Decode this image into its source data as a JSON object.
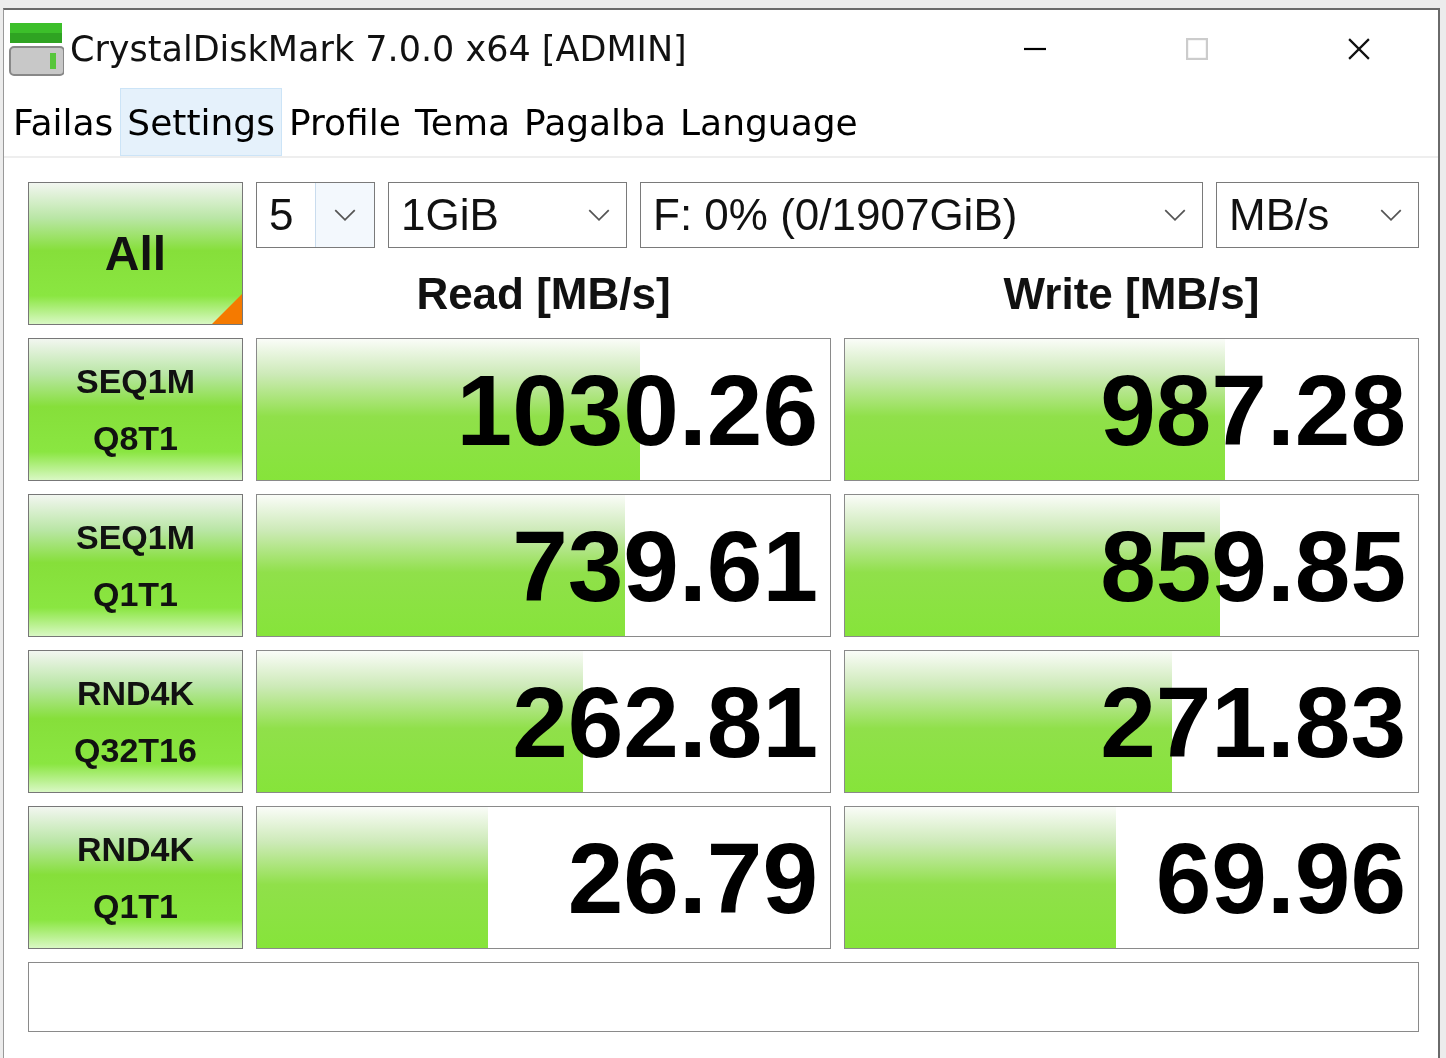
{
  "window": {
    "title": "CrystalDiskMark 7.0.0 x64 [ADMIN]"
  },
  "menu": [
    {
      "label": "Failas",
      "selected": false
    },
    {
      "label": "Settings",
      "selected": true
    },
    {
      "label": "Profile",
      "selected": false
    },
    {
      "label": "Tema",
      "selected": false
    },
    {
      "label": "Pagalba",
      "selected": false
    },
    {
      "label": "Language",
      "selected": false
    }
  ],
  "all_button": "All",
  "selectors": {
    "count": "5",
    "size": "1GiB",
    "drive": "F: 0% (0/1907GiB)",
    "unit": "MB/s"
  },
  "headers": {
    "read": "Read [MB/s]",
    "write": "Write [MB/s]"
  },
  "tests": [
    {
      "line1": "SEQ1M",
      "line2": "Q8T1",
      "read": {
        "value": "1030.26",
        "level": 0.668
      },
      "write": {
        "value": "987.28",
        "level": 0.664
      }
    },
    {
      "line1": "SEQ1M",
      "line2": "Q1T1",
      "read": {
        "value": "739.61",
        "level": 0.643
      },
      "write": {
        "value": "859.85",
        "level": 0.654
      }
    },
    {
      "line1": "RND4K",
      "line2": "Q32T16",
      "read": {
        "value": "262.81",
        "level": 0.569
      },
      "write": {
        "value": "271.83",
        "level": 0.57
      }
    },
    {
      "line1": "RND4K",
      "line2": "Q1T1",
      "read": {
        "value": "26.79",
        "level": 0.403
      },
      "write": {
        "value": "69.96",
        "level": 0.473
      }
    }
  ]
}
